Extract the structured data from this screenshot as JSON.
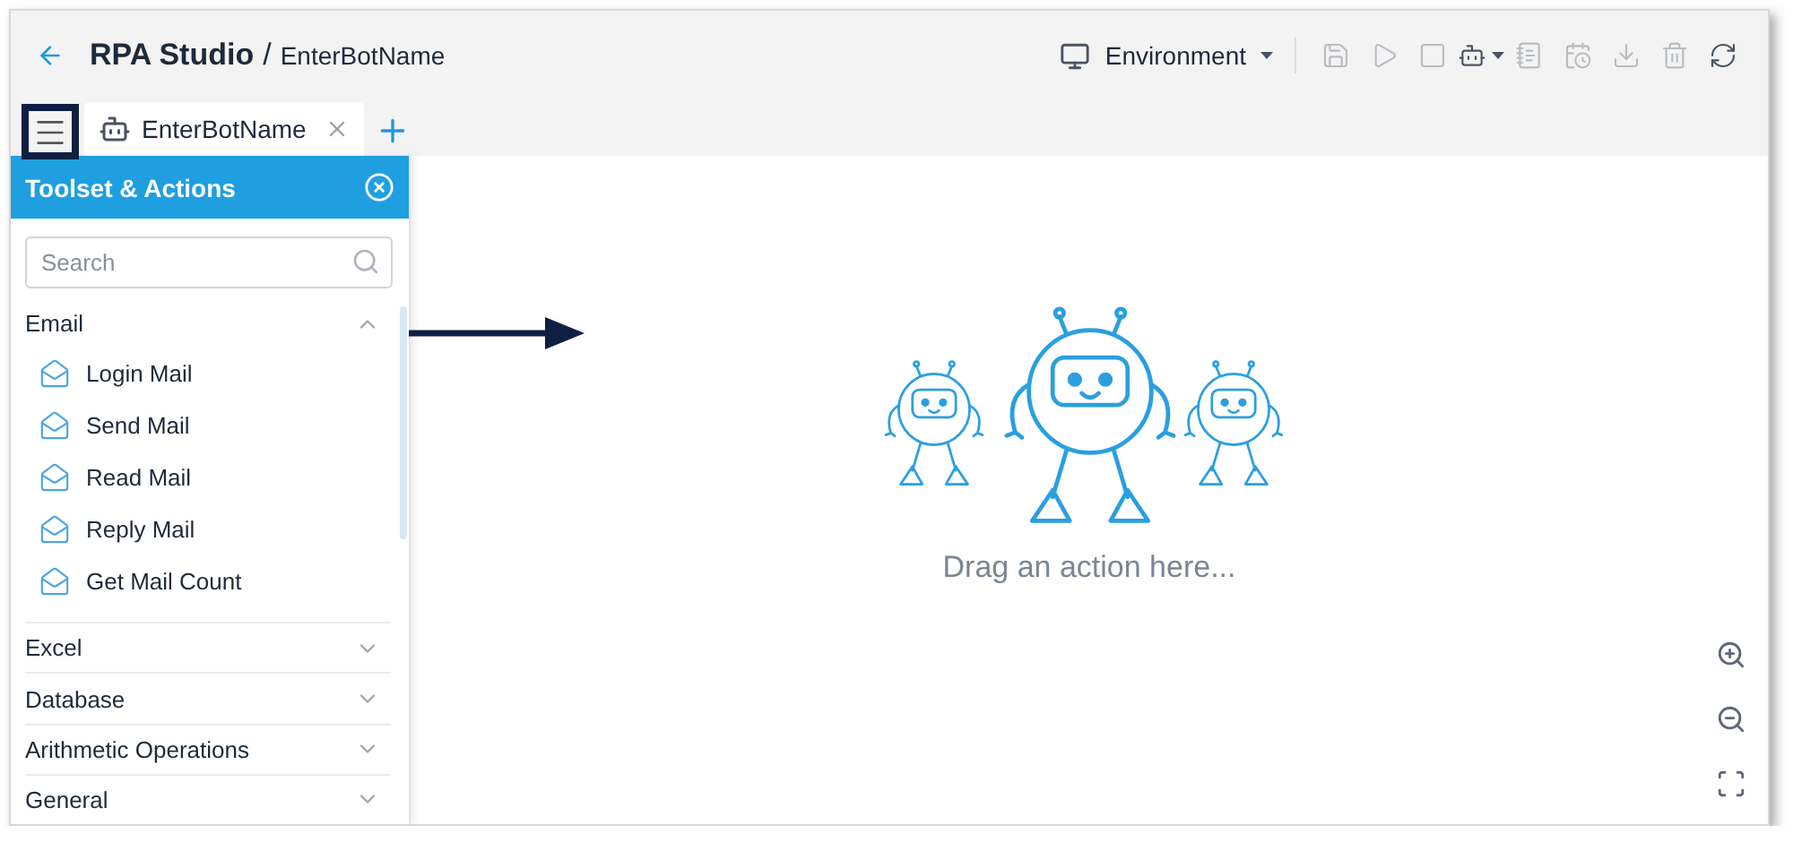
{
  "header": {
    "title": "RPA Studio",
    "separator": "/",
    "bot_name": "EnterBotName"
  },
  "environment": {
    "label": "Environment"
  },
  "toolbar": [
    {
      "kind": "save",
      "disabled": true
    },
    {
      "kind": "play",
      "disabled": true
    },
    {
      "kind": "stop",
      "disabled": true
    },
    {
      "kind": "bot",
      "disabled": false
    },
    {
      "kind": "notes",
      "disabled": true
    },
    {
      "kind": "schedule",
      "disabled": true
    },
    {
      "kind": "download",
      "disabled": true
    },
    {
      "kind": "delete",
      "disabled": true
    },
    {
      "kind": "refresh",
      "disabled": false
    }
  ],
  "menu_button": {
    "highlighted": true
  },
  "tabs": [
    {
      "label": "EnterBotName",
      "selected": true
    }
  ],
  "sidebar": {
    "title": "Toolset & Actions",
    "search": {
      "placeholder": "Search"
    },
    "groups": [
      {
        "label": "Email",
        "expanded": true,
        "items": [
          "Login Mail",
          "Send Mail",
          "Read Mail",
          "Reply Mail",
          "Get Mail Count"
        ]
      },
      {
        "label": "Excel",
        "expanded": false
      },
      {
        "label": "Database",
        "expanded": false
      },
      {
        "label": "Arithmetic Operations",
        "expanded": false
      },
      {
        "label": "General",
        "expanded": false
      }
    ]
  },
  "canvas": {
    "empty_text": "Drag an action here..."
  }
}
